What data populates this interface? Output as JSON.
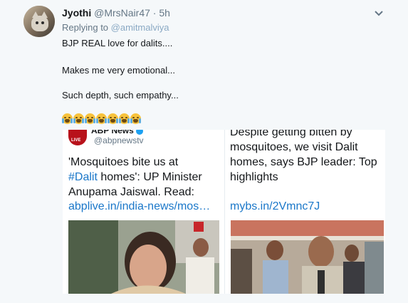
{
  "tweet": {
    "author_name": "Jyothi",
    "author_handle": "@MrsNair47",
    "separator": "·",
    "timestamp": "5h",
    "replying_to_label": "Replying to",
    "replying_to_handle": "@amitmalviya",
    "lines": [
      "BJP REAL love for dalits....",
      "Makes me very emotional...",
      "Such depth, such empathy..."
    ],
    "emoji_name": "loudly-crying-face-emoji",
    "emoji_count": 7
  },
  "cards": {
    "left": {
      "account_name": "ABP News",
      "account_handle": "@abpnewstv",
      "logo_text": "LIVE",
      "text_line1": "'Mosquitoes bite us at",
      "hashtag": "#Dalit",
      "text_line2_rest": " homes': UP Minister",
      "text_line3": "Anupama Jaiswal. Read:",
      "link": "abplive.in/india-news/mos…"
    },
    "right": {
      "text_line0": "Despite getting bitten by",
      "text_line1": "mosquitoes, we visit Dalit",
      "text_line2": "homes, says BJP leader: Top",
      "text_line3": "highlights",
      "link": "mybs.in/2Vmnc7J"
    }
  },
  "colors": {
    "link": "#1a77c9",
    "muted": "#657786",
    "background": "#f5f8fa"
  }
}
